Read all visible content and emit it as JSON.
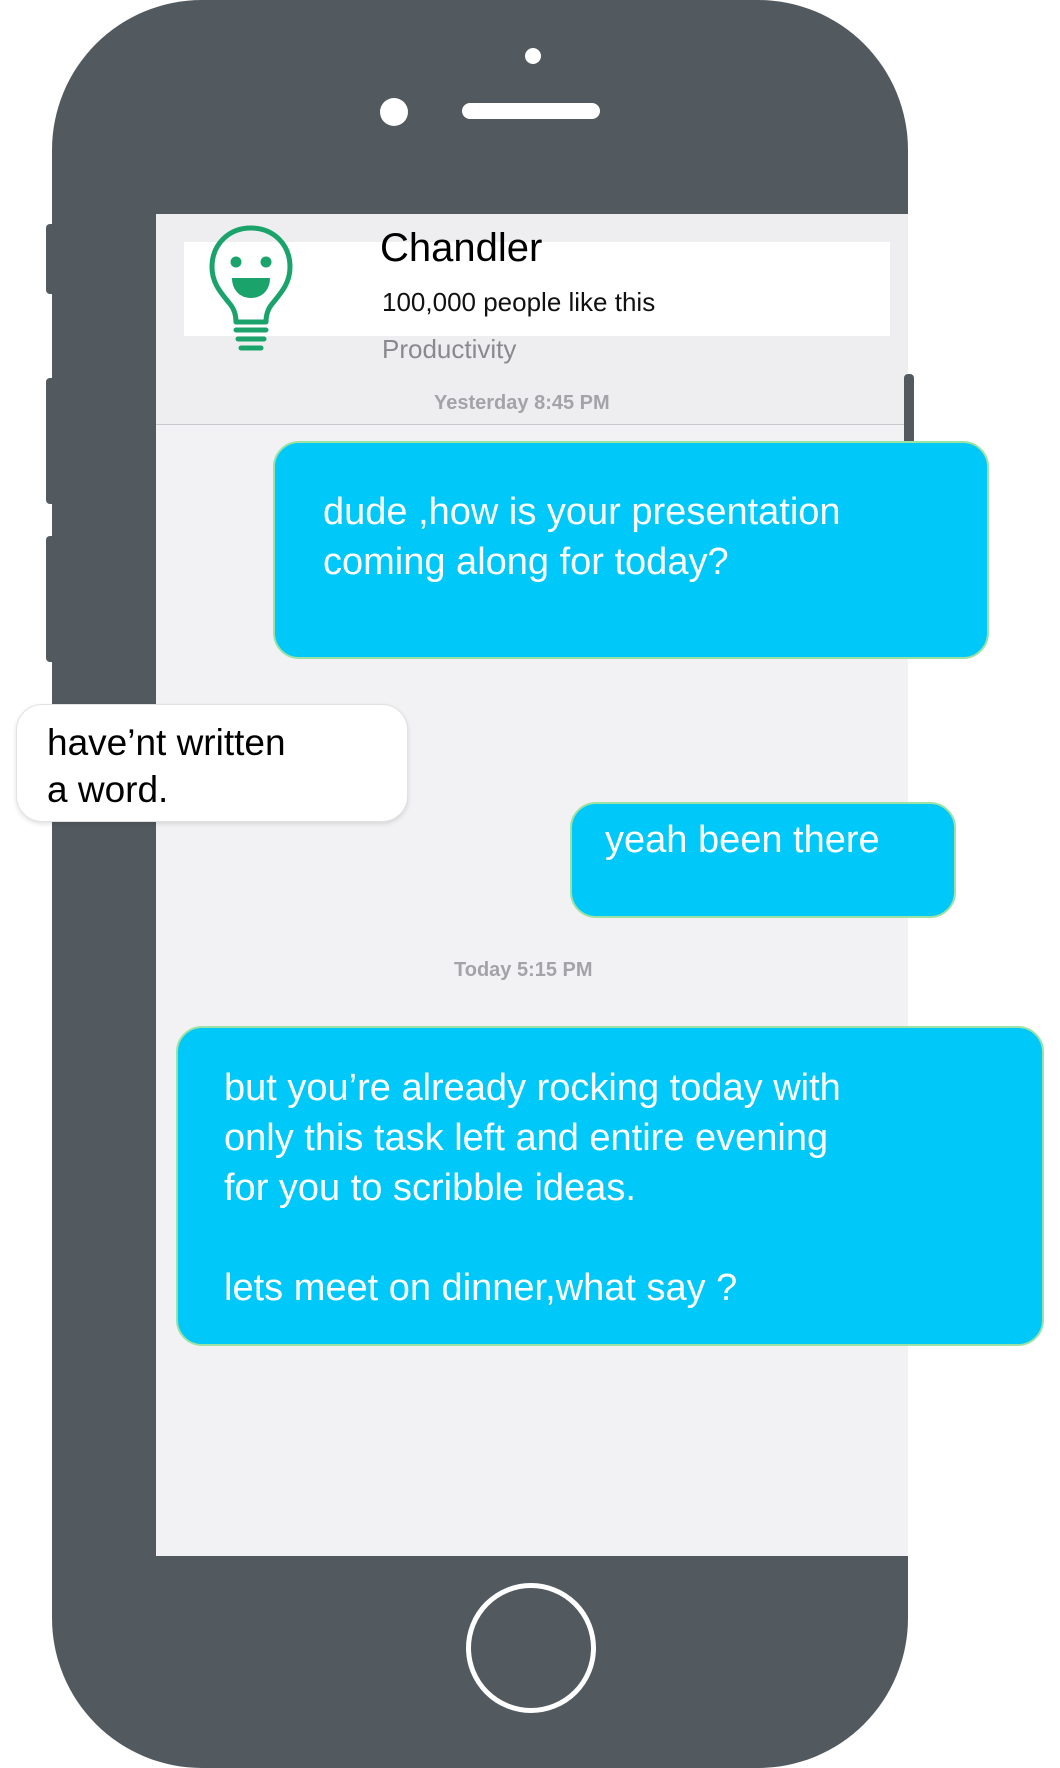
{
  "contact": {
    "name": "Chandler",
    "likes": "100,000 people like this",
    "category": "Productivity",
    "avatar_icon": "lightbulb-smile-icon",
    "avatar_color": "#1aa36b"
  },
  "timestamps": {
    "first": "Yesterday 8:45 PM",
    "second": "Today 5:15 PM"
  },
  "messages": [
    {
      "direction": "outgoing",
      "text": "dude ,how is your presentation\ncoming along for today?"
    },
    {
      "direction": "incoming",
      "text": "have’nt written\na word."
    },
    {
      "direction": "outgoing",
      "text": "yeah been there"
    },
    {
      "direction": "outgoing",
      "text": "but you’re already rocking today with\nonly this task left  and entire evening\nfor you to scribble ideas.\n\nlets meet on dinner,what say ?"
    }
  ],
  "colors": {
    "phone_body": "#525a60",
    "outgoing_bubble": "#00c8f8",
    "outgoing_border": "#9be2a4",
    "incoming_bubble": "#ffffff",
    "screen_bg": "#f2f2f4"
  }
}
